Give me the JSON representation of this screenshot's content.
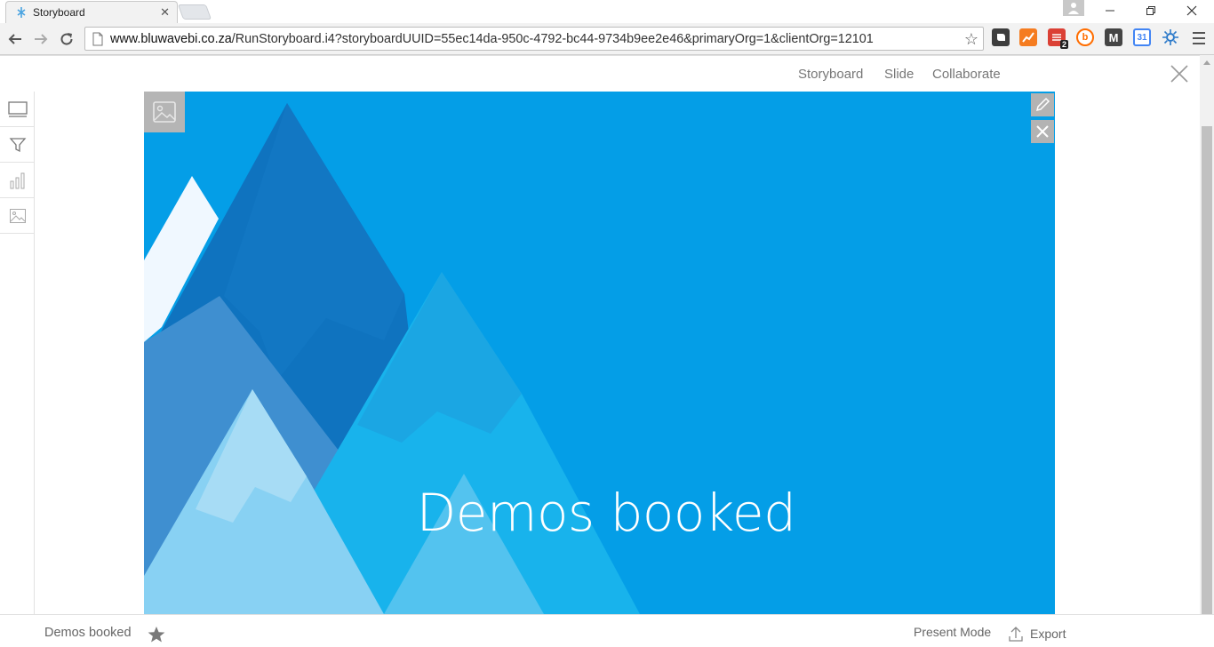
{
  "browser": {
    "tab_title": "Storyboard",
    "tab_close": "✕",
    "url_host": "www.bluwavebi.co.za",
    "url_path": "/RunStoryboard.i4?storyboardUUID=55ec14da-950c-4792-bc44-9734b9ee2e46&primaryOrg=1&clientOrg=12101",
    "extensions": [
      {
        "name": "evernote-icon",
        "color": "#3d3d3d"
      },
      {
        "name": "analytics-icon",
        "color": "#f57c20"
      },
      {
        "name": "todoist-icon",
        "color": "#db4035",
        "badge": "2"
      },
      {
        "name": "feedly-icon",
        "color": "#ff6d00"
      },
      {
        "name": "gmail-m-icon",
        "color": "#444444"
      },
      {
        "name": "calendar-icon",
        "color": "#4285f4"
      },
      {
        "name": "settings-burst-icon",
        "color": "#2b79c9"
      }
    ]
  },
  "app_header": {
    "nav": [
      "Storyboard",
      "Slide",
      "Collaborate"
    ]
  },
  "slide": {
    "title": "Demos booked",
    "background_color": "#049ee7"
  },
  "footer": {
    "title": "Demos booked",
    "present_mode": "Present Mode",
    "export": "Export"
  }
}
